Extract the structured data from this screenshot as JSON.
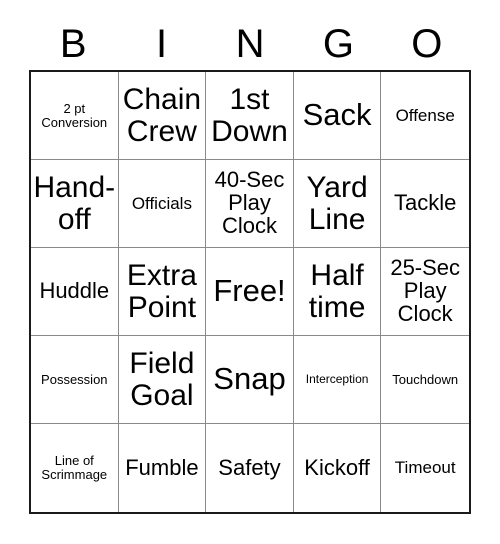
{
  "header": {
    "letters": [
      "B",
      "I",
      "N",
      "G",
      "O"
    ]
  },
  "grid": {
    "rows": 5,
    "columns": 5,
    "free_space_index": 12,
    "cells": [
      {
        "text": "2 pt\nConversion",
        "size": "xs"
      },
      {
        "text": "Chain\nCrew",
        "size": "lg"
      },
      {
        "text": "1st\nDown",
        "size": "lg"
      },
      {
        "text": "Sack",
        "size": "xl"
      },
      {
        "text": "Offense",
        "size": "sm"
      },
      {
        "text": "Hand-\noff",
        "size": "lg"
      },
      {
        "text": "Officials",
        "size": "sm"
      },
      {
        "text": "40-Sec\nPlay\nClock",
        "size": "md"
      },
      {
        "text": "Yard\nLine",
        "size": "lg"
      },
      {
        "text": "Tackle",
        "size": "md"
      },
      {
        "text": "Huddle",
        "size": "md"
      },
      {
        "text": "Extra\nPoint",
        "size": "lg"
      },
      {
        "text": "Free!",
        "size": "xl"
      },
      {
        "text": "Half\ntime",
        "size": "lg"
      },
      {
        "text": "25-Sec\nPlay\nClock",
        "size": "md"
      },
      {
        "text": "Possession",
        "size": "xs"
      },
      {
        "text": "Field\nGoal",
        "size": "lg"
      },
      {
        "text": "Snap",
        "size": "xl"
      },
      {
        "text": "Interception",
        "size": "xxs"
      },
      {
        "text": "Touchdown",
        "size": "xs"
      },
      {
        "text": "Line of\nScrimmage",
        "size": "xs"
      },
      {
        "text": "Fumble",
        "size": "md"
      },
      {
        "text": "Safety",
        "size": "md"
      },
      {
        "text": "Kickoff",
        "size": "md"
      },
      {
        "text": "Timeout",
        "size": "sm"
      }
    ]
  },
  "colors": {
    "background": "#ffffff",
    "text": "#000000",
    "outer_border": "#1a1a1a",
    "inner_border": "#8a8a8a"
  }
}
